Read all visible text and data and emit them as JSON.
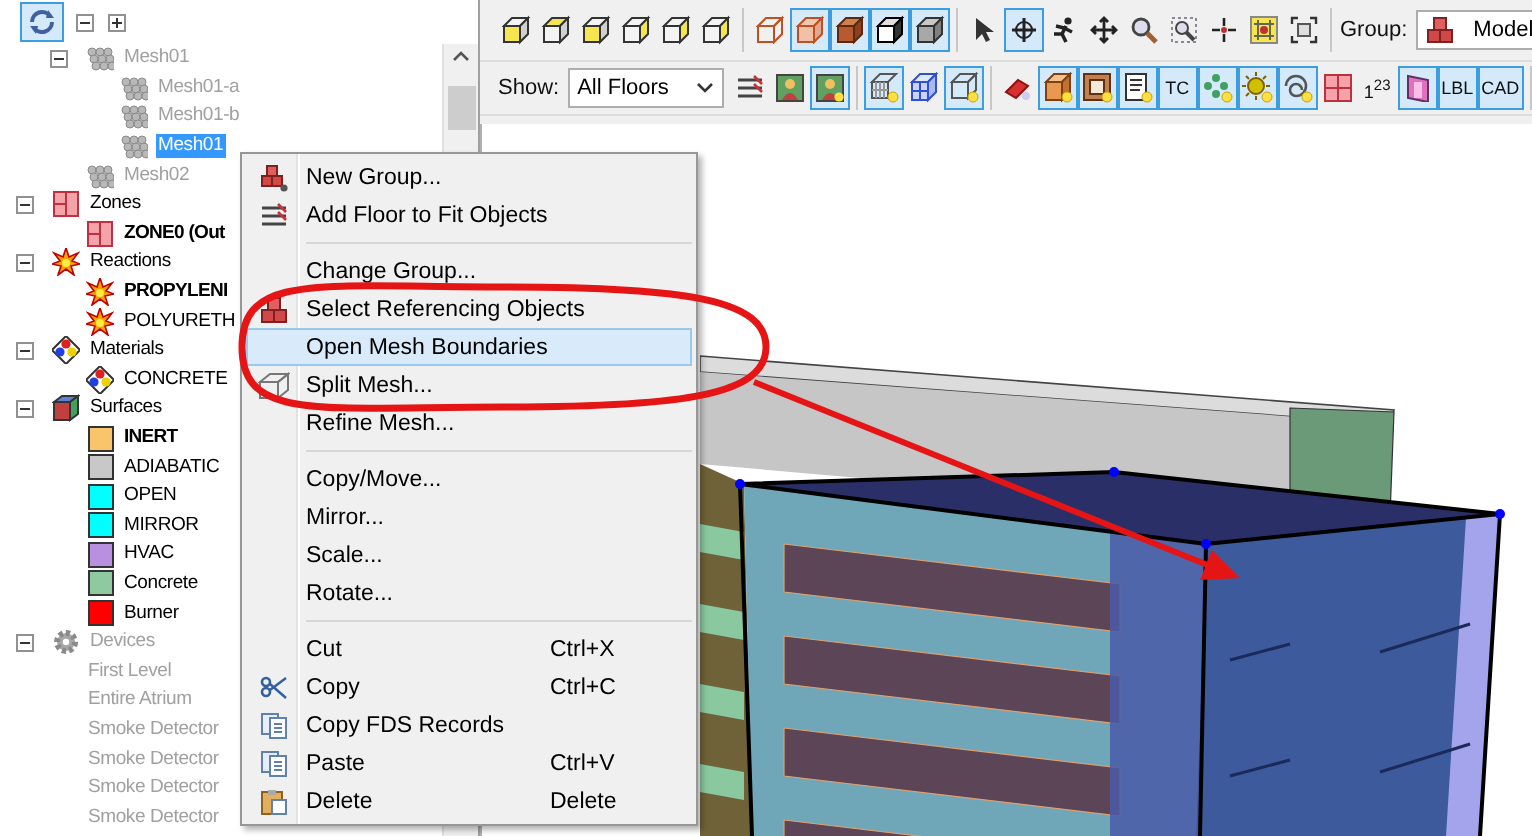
{
  "tree_toolbar": {
    "buttons": [
      {
        "selected": true
      },
      {
        "selected": false
      },
      {
        "selected": false
      }
    ]
  },
  "tree": {
    "meshes": [
      {
        "label": "Mesh01",
        "kind": "mesh",
        "disabled": true,
        "active": false,
        "selected": false,
        "expanded": true,
        "children": [
          {
            "label": "Mesh01-a",
            "kind": "mesh",
            "disabled": true,
            "active": false,
            "selected": false
          },
          {
            "label": "Mesh01-b",
            "kind": "mesh",
            "disabled": true,
            "active": false,
            "selected": false
          },
          {
            "label": "Mesh01",
            "kind": "mesh",
            "disabled": true,
            "active": false,
            "selected": true
          }
        ]
      },
      {
        "label": "Mesh02",
        "kind": "mesh",
        "disabled": true,
        "active": false,
        "selected": false
      }
    ],
    "categories": [
      {
        "label": "Zones",
        "kind": "zones",
        "disabled": false,
        "active": false,
        "selected": false,
        "expanded": true,
        "children": [
          {
            "label": "ZONE0 (Out",
            "kind": "zone",
            "disabled": false,
            "active": true,
            "selected": false
          }
        ]
      },
      {
        "label": "Reactions",
        "kind": "reactions",
        "disabled": false,
        "active": false,
        "selected": false,
        "expanded": true,
        "children": [
          {
            "label": "PROPYLENI",
            "kind": "reaction",
            "disabled": false,
            "active": true,
            "selected": false
          },
          {
            "label": "POLYURETH",
            "kind": "reaction",
            "disabled": false,
            "active": false,
            "selected": false
          }
        ]
      },
      {
        "label": "Materials",
        "kind": "materials",
        "disabled": false,
        "active": false,
        "selected": false,
        "expanded": true,
        "children": [
          {
            "label": "CONCRETE",
            "kind": "material",
            "disabled": false,
            "active": false,
            "selected": false
          }
        ]
      },
      {
        "label": "Surfaces",
        "kind": "surfaces",
        "disabled": false,
        "active": false,
        "selected": false,
        "expanded": true,
        "children": [
          {
            "label": "INERT",
            "kind": "surface",
            "color": "#f9c56b",
            "disabled": false,
            "active": true,
            "selected": false
          },
          {
            "label": "ADIABATIC",
            "kind": "surface",
            "color": "#c8c8c8",
            "disabled": false,
            "active": false,
            "selected": false
          },
          {
            "label": "OPEN",
            "kind": "surface",
            "color": "#00ffff",
            "disabled": false,
            "active": false,
            "selected": false
          },
          {
            "label": "MIRROR",
            "kind": "surface",
            "color": "#00ffff",
            "disabled": false,
            "active": false,
            "selected": false
          },
          {
            "label": "HVAC",
            "kind": "surface",
            "color": "#b890e0",
            "disabled": false,
            "active": false,
            "selected": false
          },
          {
            "label": "Concrete",
            "kind": "surface",
            "color": "#8fc9a0",
            "disabled": false,
            "active": false,
            "selected": false
          },
          {
            "label": "Burner",
            "kind": "surface",
            "color": "#ff0000",
            "disabled": false,
            "active": false,
            "selected": false
          }
        ]
      },
      {
        "label": "Devices",
        "kind": "devices",
        "disabled": true,
        "active": false,
        "selected": false,
        "expanded": true,
        "children": [
          {
            "label": "First Level",
            "kind": "device",
            "disabled": true,
            "active": false,
            "selected": false
          },
          {
            "label": "Entire Atrium",
            "kind": "device",
            "disabled": true,
            "active": false,
            "selected": false
          },
          {
            "label": "Smoke Detector",
            "kind": "device",
            "disabled": true,
            "active": false,
            "selected": false
          },
          {
            "label": "Smoke Detector",
            "kind": "device",
            "disabled": true,
            "active": false,
            "selected": false
          },
          {
            "label": "Smoke Detector",
            "kind": "device",
            "disabled": true,
            "active": false,
            "selected": false
          },
          {
            "label": "Smoke Detector",
            "kind": "device",
            "disabled": true,
            "active": false,
            "selected": false
          }
        ]
      }
    ]
  },
  "toolbar": {
    "row_1": {
      "groups": [
        [
          {
            "kind": "icon",
            "selected": false
          },
          {
            "kind": "icon",
            "selected": false
          },
          {
            "kind": "icon",
            "selected": false
          },
          {
            "kind": "icon",
            "selected": false
          },
          {
            "kind": "icon",
            "selected": false
          },
          {
            "kind": "icon",
            "selected": false
          }
        ],
        [
          {
            "kind": "icon",
            "selected": false
          },
          {
            "kind": "icon",
            "selected": true
          },
          {
            "kind": "icon",
            "selected": true
          },
          {
            "kind": "icon",
            "selected": true
          },
          {
            "kind": "icon",
            "selected": true
          }
        ],
        [
          {
            "kind": "icon",
            "selected": false
          },
          {
            "kind": "icon",
            "selected": true
          },
          {
            "kind": "icon",
            "selected": false
          },
          {
            "kind": "icon",
            "selected": false
          },
          {
            "kind": "icon",
            "selected": false
          },
          {
            "kind": "icon",
            "selected": false
          },
          {
            "kind": "icon",
            "selected": false
          },
          {
            "kind": "icon",
            "selected": false
          },
          {
            "kind": "icon",
            "selected": false
          }
        ]
      ],
      "group_label": "Group:",
      "group_value": "Model"
    },
    "row_2": {
      "show_label": "Show:",
      "show_value": "All Floors",
      "groups": [
        [
          {
            "kind": "icon",
            "selected": false
          },
          {
            "kind": "icon",
            "selected": false
          },
          {
            "kind": "icon",
            "selected": true
          }
        ],
        [
          {
            "kind": "icon",
            "selected": true
          },
          {
            "kind": "icon",
            "selected": false
          },
          {
            "kind": "icon",
            "selected": true
          }
        ],
        [
          {
            "kind": "icon",
            "selected": false
          },
          {
            "kind": "icon",
            "selected": true
          },
          {
            "kind": "icon",
            "selected": true
          },
          {
            "kind": "icon",
            "selected": true
          },
          {
            "kind": "text",
            "label": "TC",
            "selected": true
          },
          {
            "kind": "icon",
            "selected": true
          },
          {
            "kind": "icon",
            "selected": true
          },
          {
            "kind": "icon",
            "selected": true
          },
          {
            "kind": "icon",
            "selected": false
          },
          {
            "kind": "text",
            "label": "1$^{2}$$^{3}$",
            "selected": false
          },
          {
            "kind": "icon",
            "selected": true
          },
          {
            "kind": "text",
            "label": "LBL",
            "selected": true
          },
          {
            "kind": "text",
            "label": "CAD",
            "selected": true
          }
        ]
      ]
    }
  },
  "context_menu": {
    "groups": [
      [
        {
          "label": "New Group...",
          "selected": false
        },
        {
          "label": "Add Floor to Fit Objects",
          "selected": false
        }
      ],
      [
        {
          "label": "Change Group...",
          "selected": false
        },
        {
          "label": "Select Referencing Objects",
          "selected": false
        },
        {
          "label": "Open Mesh Boundaries",
          "selected": true
        },
        {
          "label": "Split Mesh...",
          "selected": false
        },
        {
          "label": "Refine Mesh...",
          "selected": false
        }
      ],
      [
        {
          "label": "Copy/Move...",
          "selected": false
        },
        {
          "label": "Mirror...",
          "selected": false
        },
        {
          "label": "Scale...",
          "selected": false
        },
        {
          "label": "Rotate...",
          "selected": false
        }
      ],
      [
        {
          "label": "Cut",
          "shortcut": "Ctrl+X",
          "selected": false
        },
        {
          "label": "Copy",
          "shortcut": "Ctrl+C",
          "selected": false
        },
        {
          "label": "Copy FDS Records",
          "selected": false
        },
        {
          "label": "Paste",
          "shortcut": "Ctrl+V",
          "selected": false
        },
        {
          "label": "Delete",
          "shortcut": "Delete",
          "selected": false
        }
      ]
    ]
  }
}
